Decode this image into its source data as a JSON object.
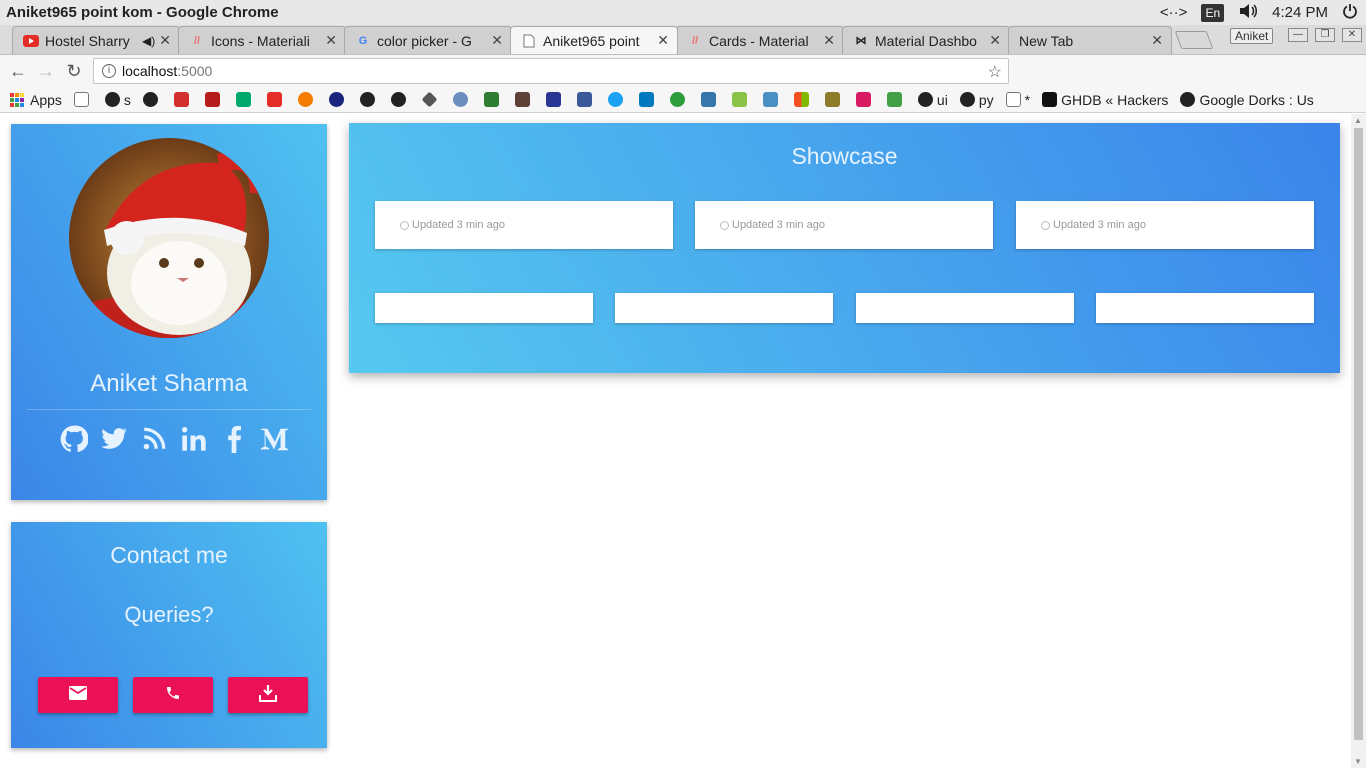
{
  "window": {
    "title": "Aniket965 point kom - Google Chrome",
    "lang": "En",
    "clock": "4:24 PM",
    "profile": "Aniket"
  },
  "tabs": [
    {
      "label": "Hostel Sharry",
      "icon": "youtube-icon",
      "audio": true
    },
    {
      "label": "Icons - Materiali",
      "icon": "materialize-icon"
    },
    {
      "label": "color picker - G",
      "icon": "google-icon"
    },
    {
      "label": "Aniket965 point",
      "icon": "page-icon",
      "active": true
    },
    {
      "label": "Cards - Material",
      "icon": "materialize-icon"
    },
    {
      "label": "Material Dashbo",
      "icon": "bowtie-icon"
    },
    {
      "label": "New Tab",
      "icon": ""
    }
  ],
  "omnibox": {
    "host": "localhost",
    "port": ":5000"
  },
  "bookmarks": {
    "apps": "Apps",
    "s": "s",
    "ui": "ui",
    "py": "py",
    "star": "*",
    "ghdb": "GHDB « Hackers",
    "dorks": "Google Dorks : Us"
  },
  "profile": {
    "name": "Aniket Sharma",
    "socials": [
      "github-icon",
      "twitter-icon",
      "rss-icon",
      "linkedin-icon",
      "facebook-icon",
      "medium-icon"
    ]
  },
  "contact": {
    "title": "Contact me",
    "queries": "Queries?",
    "buttons": [
      "email-icon",
      "phone-icon",
      "download-icon"
    ]
  },
  "showcase": {
    "title": "Showcase",
    "updated": [
      "Updated 3 min ago",
      "Updated 3 min ago",
      "Updated 3 min ago"
    ],
    "small_cards": 4
  },
  "colors": {
    "accent": "#ea1156",
    "card_gradient_start": "#3b86e8",
    "card_gradient_end": "#4fc1f0"
  }
}
